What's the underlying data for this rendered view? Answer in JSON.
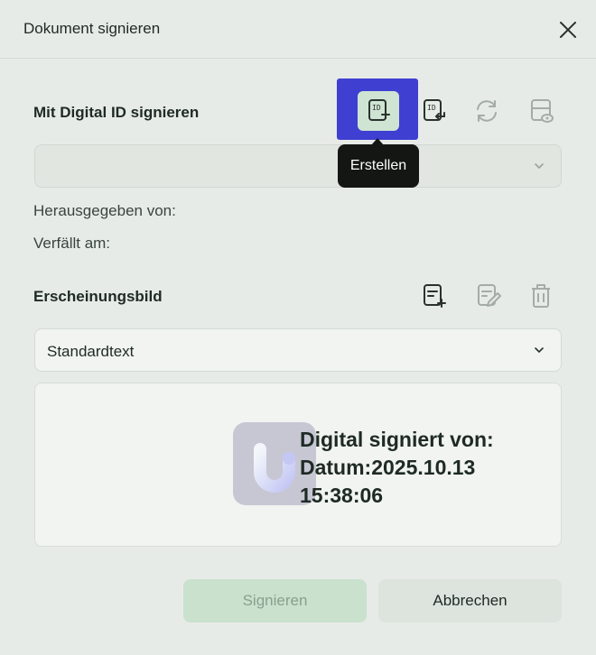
{
  "dialog": {
    "title": "Dokument signieren"
  },
  "digital_id": {
    "label": "Mit Digital ID signieren",
    "tooltip": "Erstellen",
    "selected_value": "",
    "issued_by_label": "Herausgegeben von:",
    "expires_label": "Verfällt am:",
    "icons": [
      "id-create-icon",
      "id-import-icon",
      "refresh-icon",
      "view-certificate-icon"
    ]
  },
  "appearance": {
    "label": "Erscheinungsbild",
    "selected_value": "Standardtext",
    "icons": [
      "add-appearance-icon",
      "edit-appearance-icon",
      "delete-icon"
    ],
    "preview": {
      "line1": "Digital signiert von:",
      "line2": "Datum:2025.10.13",
      "line3": "15:38:06"
    }
  },
  "buttons": {
    "sign": "Signieren",
    "cancel": "Abbrechen"
  },
  "colors": {
    "highlight": "#3f3fd1",
    "primary_disabled": "#c9e1cd",
    "tooltip_bg": "#141614"
  }
}
